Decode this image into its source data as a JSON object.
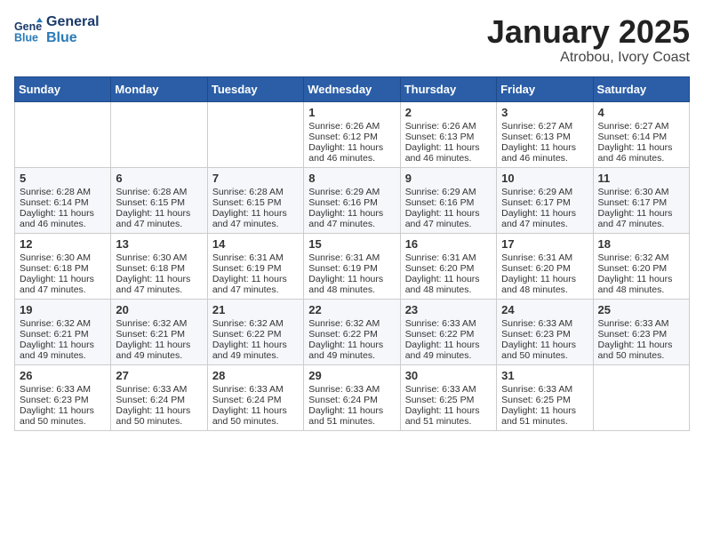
{
  "header": {
    "logo_line1": "General",
    "logo_line2": "Blue",
    "month": "January 2025",
    "location": "Atrobou, Ivory Coast"
  },
  "weekdays": [
    "Sunday",
    "Monday",
    "Tuesday",
    "Wednesday",
    "Thursday",
    "Friday",
    "Saturday"
  ],
  "weeks": [
    [
      {
        "day": "",
        "sunrise": "",
        "sunset": "",
        "daylight": ""
      },
      {
        "day": "",
        "sunrise": "",
        "sunset": "",
        "daylight": ""
      },
      {
        "day": "",
        "sunrise": "",
        "sunset": "",
        "daylight": ""
      },
      {
        "day": "1",
        "sunrise": "Sunrise: 6:26 AM",
        "sunset": "Sunset: 6:12 PM",
        "daylight": "Daylight: 11 hours and 46 minutes."
      },
      {
        "day": "2",
        "sunrise": "Sunrise: 6:26 AM",
        "sunset": "Sunset: 6:13 PM",
        "daylight": "Daylight: 11 hours and 46 minutes."
      },
      {
        "day": "3",
        "sunrise": "Sunrise: 6:27 AM",
        "sunset": "Sunset: 6:13 PM",
        "daylight": "Daylight: 11 hours and 46 minutes."
      },
      {
        "day": "4",
        "sunrise": "Sunrise: 6:27 AM",
        "sunset": "Sunset: 6:14 PM",
        "daylight": "Daylight: 11 hours and 46 minutes."
      }
    ],
    [
      {
        "day": "5",
        "sunrise": "Sunrise: 6:28 AM",
        "sunset": "Sunset: 6:14 PM",
        "daylight": "Daylight: 11 hours and 46 minutes."
      },
      {
        "day": "6",
        "sunrise": "Sunrise: 6:28 AM",
        "sunset": "Sunset: 6:15 PM",
        "daylight": "Daylight: 11 hours and 47 minutes."
      },
      {
        "day": "7",
        "sunrise": "Sunrise: 6:28 AM",
        "sunset": "Sunset: 6:15 PM",
        "daylight": "Daylight: 11 hours and 47 minutes."
      },
      {
        "day": "8",
        "sunrise": "Sunrise: 6:29 AM",
        "sunset": "Sunset: 6:16 PM",
        "daylight": "Daylight: 11 hours and 47 minutes."
      },
      {
        "day": "9",
        "sunrise": "Sunrise: 6:29 AM",
        "sunset": "Sunset: 6:16 PM",
        "daylight": "Daylight: 11 hours and 47 minutes."
      },
      {
        "day": "10",
        "sunrise": "Sunrise: 6:29 AM",
        "sunset": "Sunset: 6:17 PM",
        "daylight": "Daylight: 11 hours and 47 minutes."
      },
      {
        "day": "11",
        "sunrise": "Sunrise: 6:30 AM",
        "sunset": "Sunset: 6:17 PM",
        "daylight": "Daylight: 11 hours and 47 minutes."
      }
    ],
    [
      {
        "day": "12",
        "sunrise": "Sunrise: 6:30 AM",
        "sunset": "Sunset: 6:18 PM",
        "daylight": "Daylight: 11 hours and 47 minutes."
      },
      {
        "day": "13",
        "sunrise": "Sunrise: 6:30 AM",
        "sunset": "Sunset: 6:18 PM",
        "daylight": "Daylight: 11 hours and 47 minutes."
      },
      {
        "day": "14",
        "sunrise": "Sunrise: 6:31 AM",
        "sunset": "Sunset: 6:19 PM",
        "daylight": "Daylight: 11 hours and 47 minutes."
      },
      {
        "day": "15",
        "sunrise": "Sunrise: 6:31 AM",
        "sunset": "Sunset: 6:19 PM",
        "daylight": "Daylight: 11 hours and 48 minutes."
      },
      {
        "day": "16",
        "sunrise": "Sunrise: 6:31 AM",
        "sunset": "Sunset: 6:20 PM",
        "daylight": "Daylight: 11 hours and 48 minutes."
      },
      {
        "day": "17",
        "sunrise": "Sunrise: 6:31 AM",
        "sunset": "Sunset: 6:20 PM",
        "daylight": "Daylight: 11 hours and 48 minutes."
      },
      {
        "day": "18",
        "sunrise": "Sunrise: 6:32 AM",
        "sunset": "Sunset: 6:20 PM",
        "daylight": "Daylight: 11 hours and 48 minutes."
      }
    ],
    [
      {
        "day": "19",
        "sunrise": "Sunrise: 6:32 AM",
        "sunset": "Sunset: 6:21 PM",
        "daylight": "Daylight: 11 hours and 49 minutes."
      },
      {
        "day": "20",
        "sunrise": "Sunrise: 6:32 AM",
        "sunset": "Sunset: 6:21 PM",
        "daylight": "Daylight: 11 hours and 49 minutes."
      },
      {
        "day": "21",
        "sunrise": "Sunrise: 6:32 AM",
        "sunset": "Sunset: 6:22 PM",
        "daylight": "Daylight: 11 hours and 49 minutes."
      },
      {
        "day": "22",
        "sunrise": "Sunrise: 6:32 AM",
        "sunset": "Sunset: 6:22 PM",
        "daylight": "Daylight: 11 hours and 49 minutes."
      },
      {
        "day": "23",
        "sunrise": "Sunrise: 6:33 AM",
        "sunset": "Sunset: 6:22 PM",
        "daylight": "Daylight: 11 hours and 49 minutes."
      },
      {
        "day": "24",
        "sunrise": "Sunrise: 6:33 AM",
        "sunset": "Sunset: 6:23 PM",
        "daylight": "Daylight: 11 hours and 50 minutes."
      },
      {
        "day": "25",
        "sunrise": "Sunrise: 6:33 AM",
        "sunset": "Sunset: 6:23 PM",
        "daylight": "Daylight: 11 hours and 50 minutes."
      }
    ],
    [
      {
        "day": "26",
        "sunrise": "Sunrise: 6:33 AM",
        "sunset": "Sunset: 6:23 PM",
        "daylight": "Daylight: 11 hours and 50 minutes."
      },
      {
        "day": "27",
        "sunrise": "Sunrise: 6:33 AM",
        "sunset": "Sunset: 6:24 PM",
        "daylight": "Daylight: 11 hours and 50 minutes."
      },
      {
        "day": "28",
        "sunrise": "Sunrise: 6:33 AM",
        "sunset": "Sunset: 6:24 PM",
        "daylight": "Daylight: 11 hours and 50 minutes."
      },
      {
        "day": "29",
        "sunrise": "Sunrise: 6:33 AM",
        "sunset": "Sunset: 6:24 PM",
        "daylight": "Daylight: 11 hours and 51 minutes."
      },
      {
        "day": "30",
        "sunrise": "Sunrise: 6:33 AM",
        "sunset": "Sunset: 6:25 PM",
        "daylight": "Daylight: 11 hours and 51 minutes."
      },
      {
        "day": "31",
        "sunrise": "Sunrise: 6:33 AM",
        "sunset": "Sunset: 6:25 PM",
        "daylight": "Daylight: 11 hours and 51 minutes."
      },
      {
        "day": "",
        "sunrise": "",
        "sunset": "",
        "daylight": ""
      }
    ]
  ]
}
